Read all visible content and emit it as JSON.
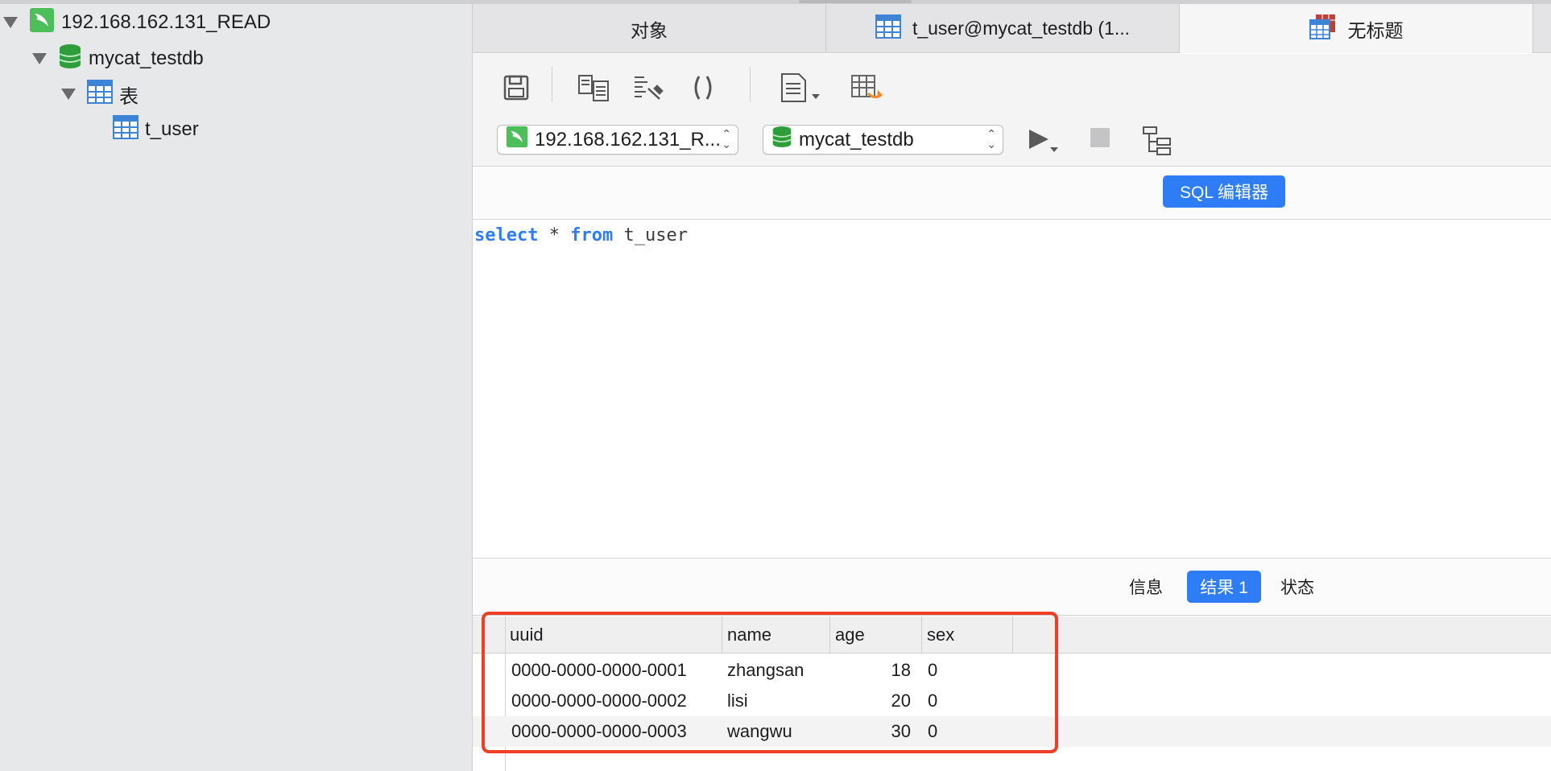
{
  "sidebar": {
    "connection": "192.168.162.131_READ",
    "database": "mycat_testdb",
    "tables_folder": "表",
    "table": "t_user"
  },
  "tabs": [
    {
      "label": "对象"
    },
    {
      "label": "t_user@mycat_testdb (1..."
    },
    {
      "label": "无标题"
    }
  ],
  "toolbar": {
    "icons": [
      "save-icon",
      "format-icon",
      "beautify-icon",
      "parentheses-icon",
      "snippet-icon",
      "export-icon"
    ],
    "connection_select": "192.168.162.131_R...",
    "database_select": "mycat_testdb"
  },
  "editor": {
    "header_button": "SQL 编辑器",
    "sql": {
      "kw1": "select",
      "star": " * ",
      "kw2": "from",
      "table": " t_user"
    }
  },
  "result_tabs": [
    "信息",
    "结果 1",
    "状态"
  ],
  "result_grid": {
    "columns": [
      "uuid",
      "name",
      "age",
      "sex"
    ],
    "rows": [
      [
        "0000-0000-0000-0001",
        "zhangsan",
        "18",
        "0"
      ],
      [
        "0000-0000-0000-0002",
        "lisi",
        "20",
        "0"
      ],
      [
        "0000-0000-0000-0003",
        "wangwu",
        "30",
        "0"
      ]
    ]
  },
  "colors": {
    "accent": "#2f7df6",
    "highlight": "#ef3e25",
    "db_green": "#3aa33a"
  }
}
